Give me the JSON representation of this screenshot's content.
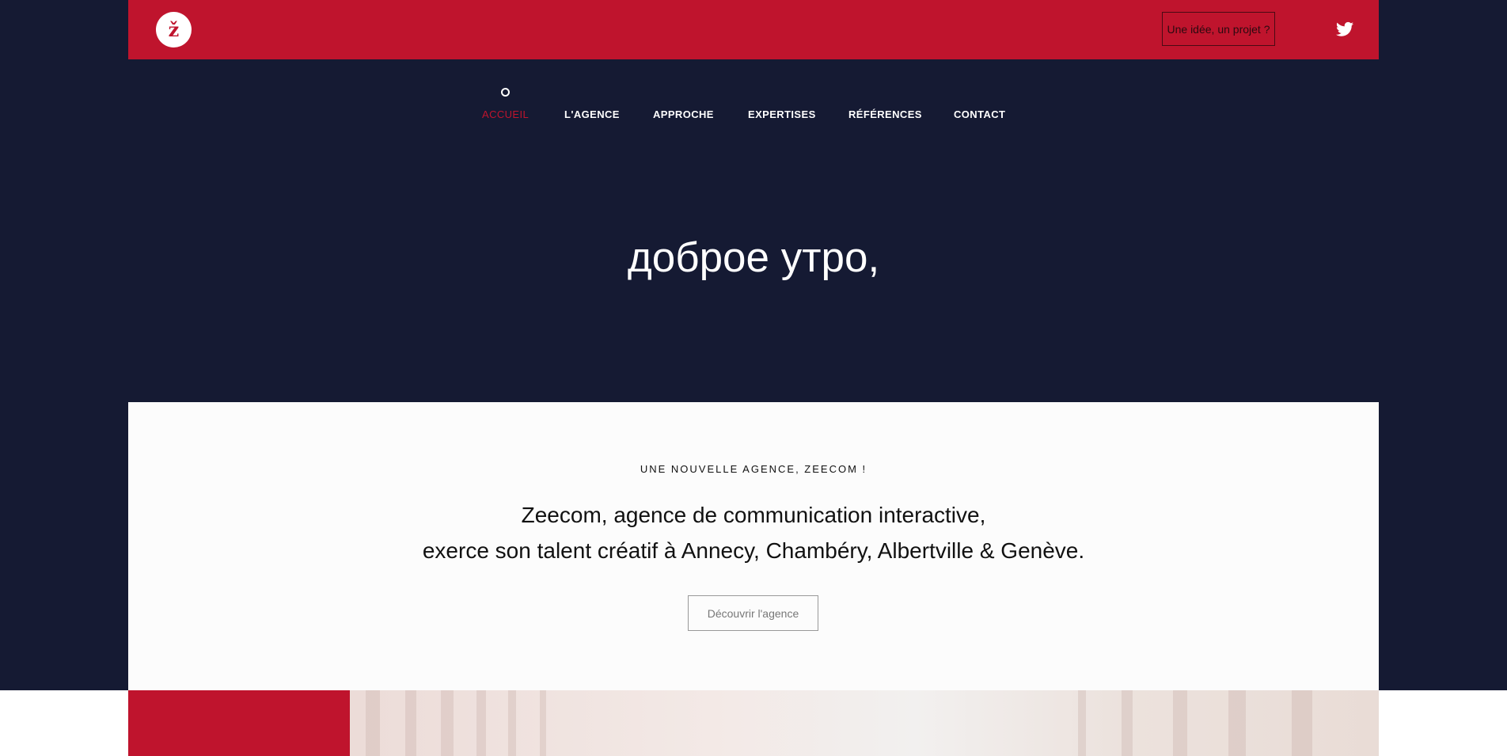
{
  "header": {
    "logo_letter": "ž",
    "cta_label": "Une idée, un projet ?",
    "social_icon": "twitter-icon",
    "accent_color": "#bf142d"
  },
  "nav": {
    "items": [
      {
        "label": "ACCUEIL",
        "active": true
      },
      {
        "label": "L'AGENCE"
      },
      {
        "label": "APPROCHE"
      },
      {
        "label": "EXPERTISES"
      },
      {
        "label": "RÉFÉRENCES"
      },
      {
        "label": "CONTACT"
      }
    ]
  },
  "hero": {
    "title": "доброе утро,",
    "background": "#151a33"
  },
  "intro": {
    "eyebrow": "UNE NOUVELLE AGENCE, ZEECOM !",
    "lead_line1": "Zeecom, agence de communication interactive,",
    "lead_line2": "exerce son talent créatif à Annecy, Chambéry, Albertville & Genève.",
    "button_label": "Découvrir l'agence"
  }
}
